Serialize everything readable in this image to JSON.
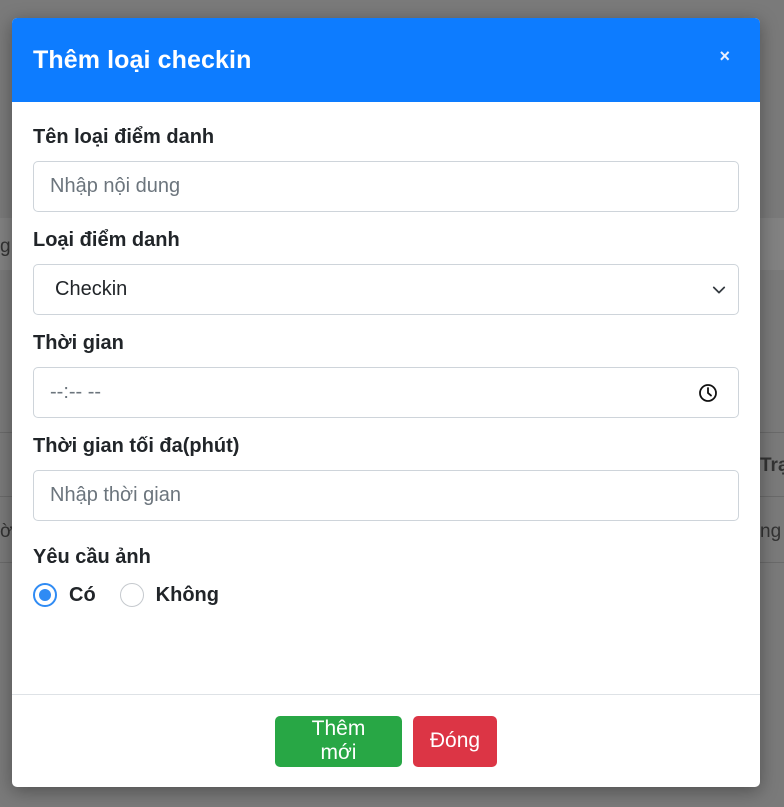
{
  "modal": {
    "title": "Thêm loại checkin",
    "close_label": "×"
  },
  "form": {
    "name": {
      "label": "Tên loại điểm danh",
      "placeholder": "Nhập nội dung"
    },
    "type": {
      "label": "Loại điểm danh",
      "selected": "Checkin"
    },
    "time": {
      "label": "Thời gian",
      "value": "--:-- --"
    },
    "max_time": {
      "label": "Thời gian tối đa(phút)",
      "placeholder": "Nhập thời gian"
    },
    "photo": {
      "label": "Yêu cầu ảnh",
      "options": [
        {
          "label": "Có",
          "checked": true
        },
        {
          "label": "Không",
          "checked": false
        }
      ]
    }
  },
  "footer": {
    "add_label": "Thêm mới",
    "close_label": "Đóng"
  },
  "background": {
    "frag_g": "g",
    "frag_tra": "Trạ",
    "frag_o": "ờn",
    "frag_ng": "ng"
  },
  "colors": {
    "header": "#0d7cff",
    "success": "#28a745",
    "danger": "#dc3545",
    "radio": "#2f8bf4"
  }
}
